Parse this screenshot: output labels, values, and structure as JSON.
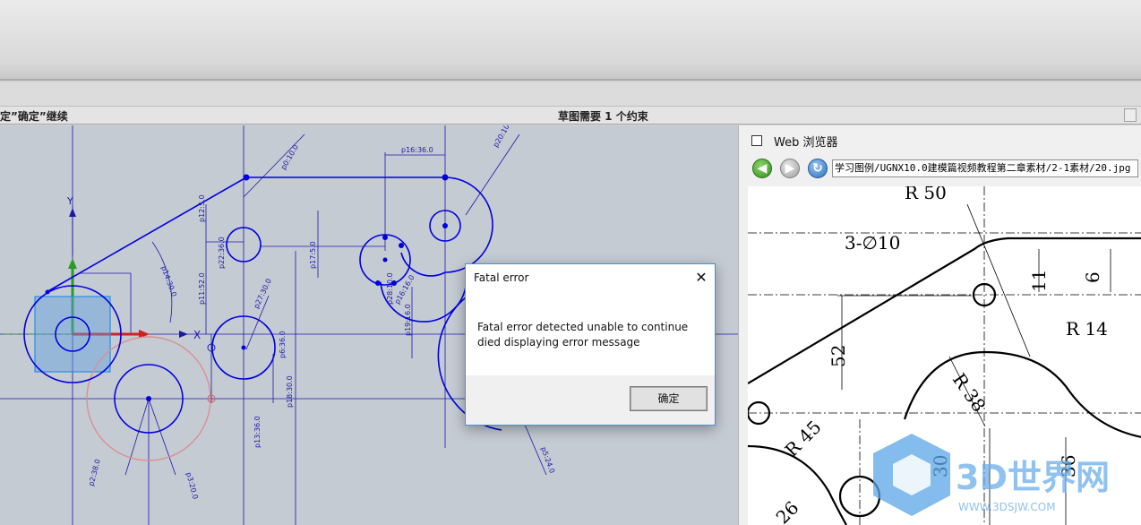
{
  "status_bar": {
    "prompt_text": "定”确定”继续",
    "sketch_status": "草图需要 1 个约束"
  },
  "sketch": {
    "dimensions": [
      "p16:36.0",
      "p20:10.0",
      "p0:10.0",
      "p12:5.0",
      "p14:30.0",
      "p11:52.0",
      "p17:5.0",
      "p27:30.0",
      "p16:16.0",
      "p19:16.0",
      "p28:10.0",
      "p18:30.0",
      "p13:36.0",
      "p6:36.0",
      "p2:38.0",
      "p3:20.0",
      "p5:24.0",
      "p22:36.0"
    ],
    "axis_x_label": "X",
    "axis_y_label": "Y",
    "colors": {
      "geometry": "#0000e0",
      "reference_circle": "#e0a0a0",
      "dimension": "#1a1aa8",
      "selection_box": "#3aa0e8"
    }
  },
  "web_browser": {
    "title": "Web 浏览器",
    "back_icon": "arrow-left-icon",
    "forward_icon": "arrow-right-icon",
    "refresh_icon": "refresh-icon",
    "url": "学习图例/UGNX10.0建模篇视频教程第二章素材/2-1素材/20.jpg",
    "drawing_labels": [
      "R 50",
      "3-∅10",
      "11",
      "6",
      "R 14",
      "52",
      "R 38",
      "R 45",
      "30",
      "36",
      "26"
    ],
    "watermark_text": "3D世界网",
    "watermark_sub": "WWW.3DSJW.COM"
  },
  "dialog": {
    "title": "Fatal error",
    "close_icon": "close-icon",
    "message_line1": "Fatal error detected unable to continue",
    "message_line2": "died displaying error message",
    "ok_label": "确定"
  }
}
